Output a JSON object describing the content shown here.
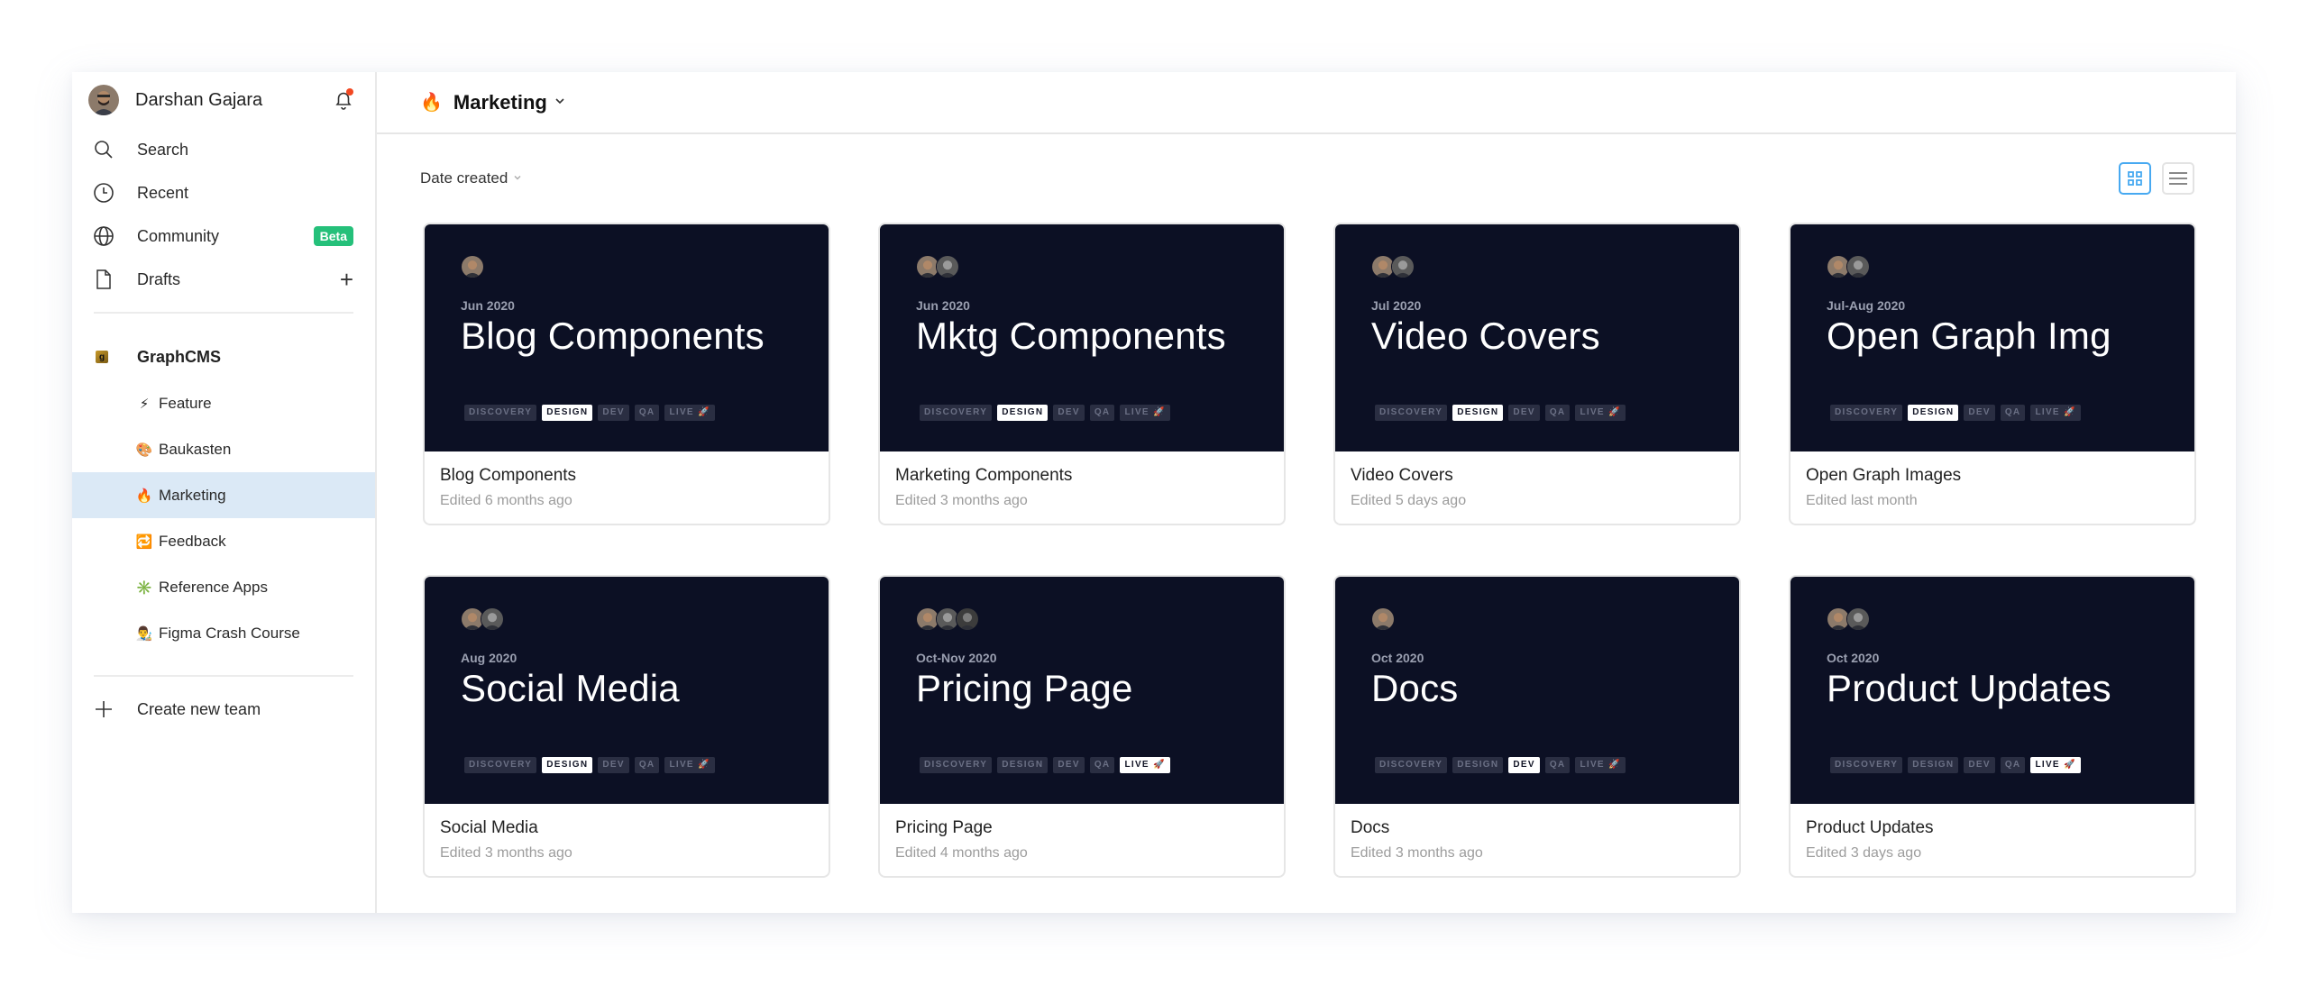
{
  "sidebar": {
    "user": {
      "name": "Darshan Gajara",
      "has_notification": true
    },
    "nav": [
      {
        "label": "Search",
        "icon": "search-icon"
      },
      {
        "label": "Recent",
        "icon": "clock-icon"
      },
      {
        "label": "Community",
        "icon": "globe-icon",
        "badge": "Beta"
      },
      {
        "label": "Drafts",
        "icon": "file-icon",
        "action": "+"
      }
    ],
    "team": {
      "name": "GraphCMS",
      "logo": "g"
    },
    "projects": [
      {
        "emoji": "⚡",
        "label": "Feature",
        "active": false
      },
      {
        "emoji": "🎨",
        "label": "Baukasten",
        "active": false
      },
      {
        "emoji": "🔥",
        "label": "Marketing",
        "active": true
      },
      {
        "emoji": "🔁",
        "label": "Feedback",
        "active": false
      },
      {
        "emoji": "✳️",
        "label": "Reference Apps",
        "active": false
      },
      {
        "emoji": "👨‍🎨",
        "label": "Figma Crash Course",
        "active": false
      }
    ],
    "create_team": {
      "label": "Create new team",
      "icon": "+"
    }
  },
  "header": {
    "emoji": "🔥",
    "title": "Marketing",
    "chevron": "⌄"
  },
  "toolbar": {
    "sort_label": "Date created",
    "sort_chevron": "⌄",
    "views": [
      {
        "name": "grid",
        "active": true
      },
      {
        "name": "list",
        "active": false
      }
    ]
  },
  "colors": {
    "accent": "#47a9f1",
    "selected_bg": "#dbe9f6",
    "beta_badge": "#25c07a",
    "thumb_bg": "#0c1024",
    "notification_dot": "#f24822"
  },
  "stages": [
    "DISCOVERY",
    "DESIGN",
    "DEV",
    "QA",
    "LIVE 🚀"
  ],
  "files": [
    {
      "date": "Jun 2020",
      "thumb_title": "Blog Components",
      "title": "Blog Components",
      "edited": "Edited 6 months ago",
      "avatars": 1,
      "stage": "DESIGN"
    },
    {
      "date": "Jun 2020",
      "thumb_title": "Mktg Components",
      "title": "Marketing Components",
      "edited": "Edited 3 months ago",
      "avatars": 2,
      "stage": "DESIGN"
    },
    {
      "date": "Jul 2020",
      "thumb_title": "Video Covers",
      "title": "Video Covers",
      "edited": "Edited 5 days ago",
      "avatars": 2,
      "stage": "DESIGN"
    },
    {
      "date": "Jul-Aug 2020",
      "thumb_title": "Open Graph Img",
      "title": "Open Graph Images",
      "edited": "Edited last month",
      "avatars": 2,
      "stage": "DESIGN"
    },
    {
      "date": "Aug 2020",
      "thumb_title": "Social Media",
      "title": "Social Media",
      "edited": "Edited 3 months ago",
      "avatars": 2,
      "stage": "DESIGN"
    },
    {
      "date": "Oct-Nov 2020",
      "thumb_title": "Pricing Page",
      "title": "Pricing Page",
      "edited": "Edited 4 months ago",
      "avatars": 3,
      "stage": "LIVE 🚀"
    },
    {
      "date": "Oct 2020",
      "thumb_title": "Docs",
      "title": "Docs",
      "edited": "Edited 3 months ago",
      "avatars": 1,
      "stage": "DEV"
    },
    {
      "date": "Oct 2020",
      "thumb_title": "Product Updates",
      "title": "Product Updates",
      "edited": "Edited 3 days ago",
      "avatars": 2,
      "stage": "LIVE 🚀"
    }
  ]
}
